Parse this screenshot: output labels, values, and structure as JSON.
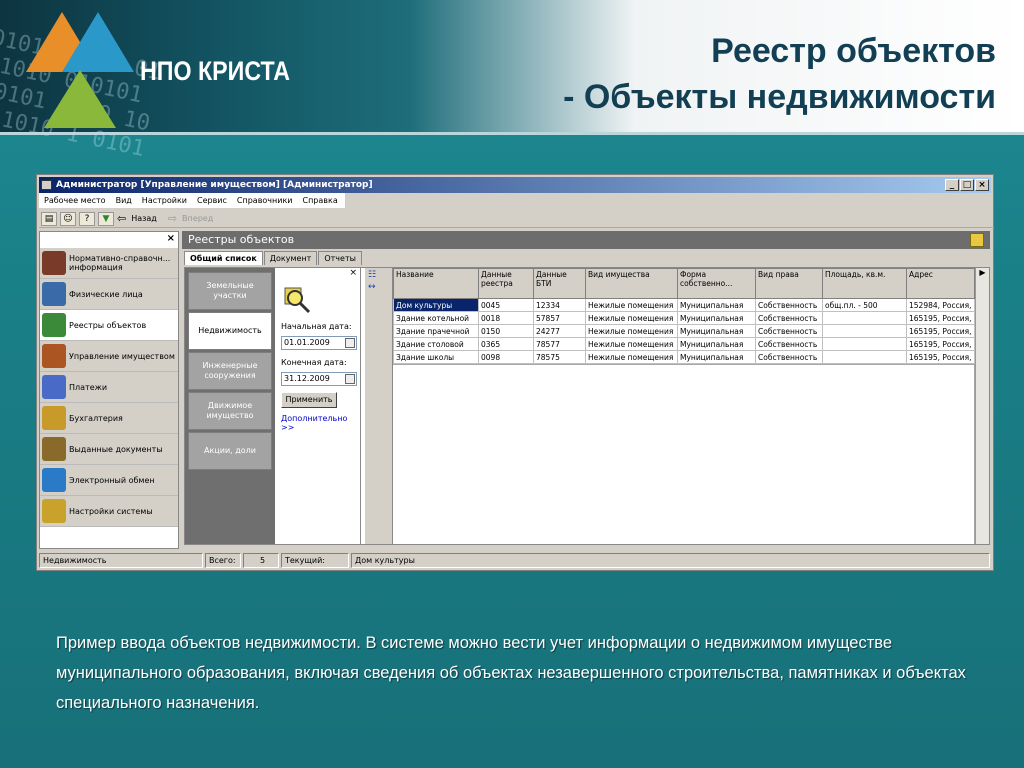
{
  "slide": {
    "logo_text": "НПО КРИСТА",
    "title_line1": "Реестр объектов",
    "title_line2": "- Объекты недвижимости",
    "caption": "Пример ввода объектов недвижимости. В системе можно вести учет информации о недвижимом имуществе муниципального образования, включая сведения об объектах незавершенного строительства, памятниках и объектах специального назначения."
  },
  "window": {
    "title": "Администратор [Управление имуществом] [Администратор]",
    "menu": [
      "Рабочее место",
      "Вид",
      "Настройки",
      "Сервис",
      "Справочники",
      "Справка"
    ],
    "toolbar": {
      "back_label": "Назад",
      "forward_label": "Вперед"
    }
  },
  "nav": {
    "items": [
      {
        "label": "Нормативно-справочн... информация",
        "icon": "books-icon",
        "color": "#7a3a2a"
      },
      {
        "label": "Физические лица",
        "icon": "person-icon",
        "color": "#3a6aa8"
      },
      {
        "label": "Реестры объектов",
        "icon": "house-icon",
        "color": "#3a8a3a"
      },
      {
        "label": "Управление имуществом",
        "icon": "building-icon",
        "color": "#aa5522"
      },
      {
        "label": "Платежи",
        "icon": "payments-icon",
        "color": "#4a6ac8"
      },
      {
        "label": "Бухгалтерия",
        "icon": "accounting-icon",
        "color": "#c89a2a"
      },
      {
        "label": "Выданные документы",
        "icon": "documents-icon",
        "color": "#8a6a2a"
      },
      {
        "label": "Электронный обмен",
        "icon": "globe-icon",
        "color": "#2a7ac8"
      },
      {
        "label": "Настройки системы",
        "icon": "settings-icon",
        "color": "#c8a22a"
      }
    ]
  },
  "main": {
    "header": "Реестры объектов",
    "tabs": [
      "Общий список",
      "Документ",
      "Отчеты"
    ],
    "subcategories": [
      "Земельные участки",
      "Недвижимость",
      "Инженерные сооружения",
      "Движимое имущество",
      "Акции, доли"
    ],
    "filter": {
      "start_label": "Начальная дата:",
      "start_value": "01.01.2009",
      "end_label": "Конечная дата:",
      "end_value": "31.12.2009",
      "apply_label": "Применить",
      "more_link": "Дополнительно >>"
    },
    "table": {
      "columns": [
        "Название",
        "Данные реестра",
        "Данные БТИ",
        "Вид имущества",
        "Форма собственно...",
        "Вид права",
        "Площадь, кв.м.",
        "Адрес"
      ],
      "rows": [
        [
          "Дом культуры",
          "0045",
          "12334",
          "Нежилые помещения",
          "Муниципальная",
          "Собственность",
          "общ.пл. - 500",
          "152984, Россия,"
        ],
        [
          "Здание котельной",
          "0018",
          "57857",
          "Нежилые помещения",
          "Муниципальная",
          "Собственность",
          "",
          "165195, Россия,"
        ],
        [
          "Здание прачечной",
          "0150",
          "24277",
          "Нежилые помещения",
          "Муниципальная",
          "Собственность",
          "",
          "165195, Россия,"
        ],
        [
          "Здание столовой",
          "0365",
          "78577",
          "Нежилые помещения",
          "Муниципальная",
          "Собственность",
          "",
          "165195, Россия,"
        ],
        [
          "Здание школы",
          "0098",
          "78575",
          "Нежилые помещения",
          "Муниципальная",
          "Собственность",
          "",
          "165195, Россия,"
        ]
      ]
    }
  },
  "status": {
    "section": "Недвижимость",
    "total_label": "Всего:",
    "total_value": "5",
    "current_label": "Текущий:",
    "current_value": "Дом культуры"
  }
}
